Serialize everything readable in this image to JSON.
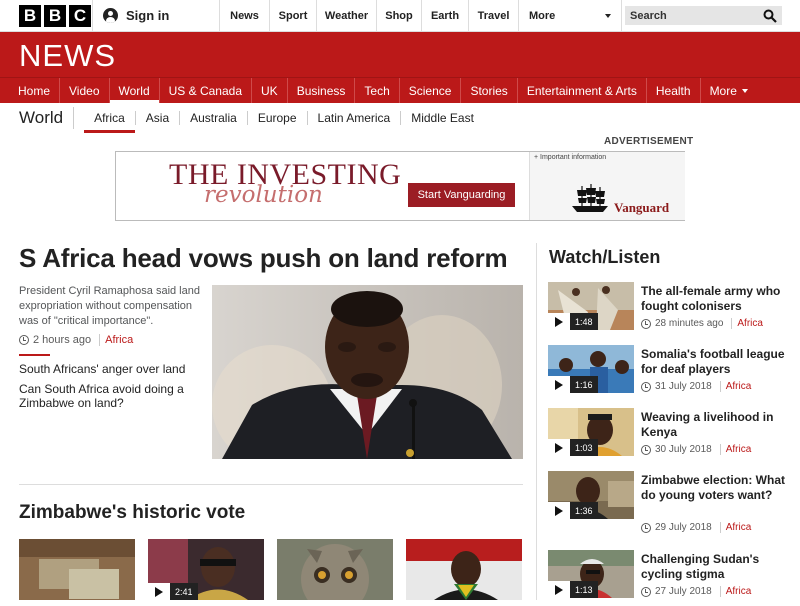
{
  "brand": {
    "letters": [
      "B",
      "B",
      "C"
    ],
    "section": "NEWS"
  },
  "account": {
    "signin": "Sign in"
  },
  "top_nav": [
    "News",
    "Sport",
    "Weather",
    "Shop",
    "Earth",
    "Travel"
  ],
  "top_more": "More",
  "search": {
    "placeholder": "Search"
  },
  "main_nav": [
    "Home",
    "Video",
    "World",
    "US & Canada",
    "UK",
    "Business",
    "Tech",
    "Science",
    "Stories",
    "Entertainment & Arts",
    "Health"
  ],
  "main_nav_active": "World",
  "main_more": "More",
  "sub_nav": {
    "title": "World",
    "items": [
      "Africa",
      "Asia",
      "Australia",
      "Europe",
      "Latin America",
      "Middle East"
    ],
    "active": "Africa"
  },
  "advert": {
    "label": "ADVERTISEMENT",
    "headline": "THE INVESTING",
    "script": "revolution",
    "cta": "Start Vanguarding",
    "info": "+ Important information",
    "brand": "Vanguard"
  },
  "top_story": {
    "headline": "S Africa head vows push on land reform",
    "summary": "President Cyril Ramaphosa said land expropriation without compensation was of \"critical importance\".",
    "time": "2 hours ago",
    "tag": "Africa",
    "related": [
      "South Africans' anger over land",
      "Can South Africa avoid doing a Zimbabwe on land?"
    ]
  },
  "section2": {
    "title": "Zimbabwe's historic vote",
    "thumb_duration": "2:41"
  },
  "watch_listen": {
    "title": "Watch/Listen",
    "items": [
      {
        "title": "The all-female army who fought colonisers",
        "duration": "1:48",
        "time": "28 minutes ago",
        "tag": "Africa"
      },
      {
        "title": "Somalia's football league for deaf players",
        "duration": "1:16",
        "time": "31 July 2018",
        "tag": "Africa"
      },
      {
        "title": "Weaving a livelihood in Kenya",
        "duration": "1:03",
        "time": "30 July 2018",
        "tag": "Africa"
      },
      {
        "title": "Zimbabwe election: What do young voters want?",
        "duration": "1:36",
        "time": "29 July 2018",
        "tag": "Africa"
      },
      {
        "title": "Challenging Sudan's cycling stigma",
        "duration": "1:13",
        "time": "27 July 2018",
        "tag": "Africa"
      }
    ]
  }
}
